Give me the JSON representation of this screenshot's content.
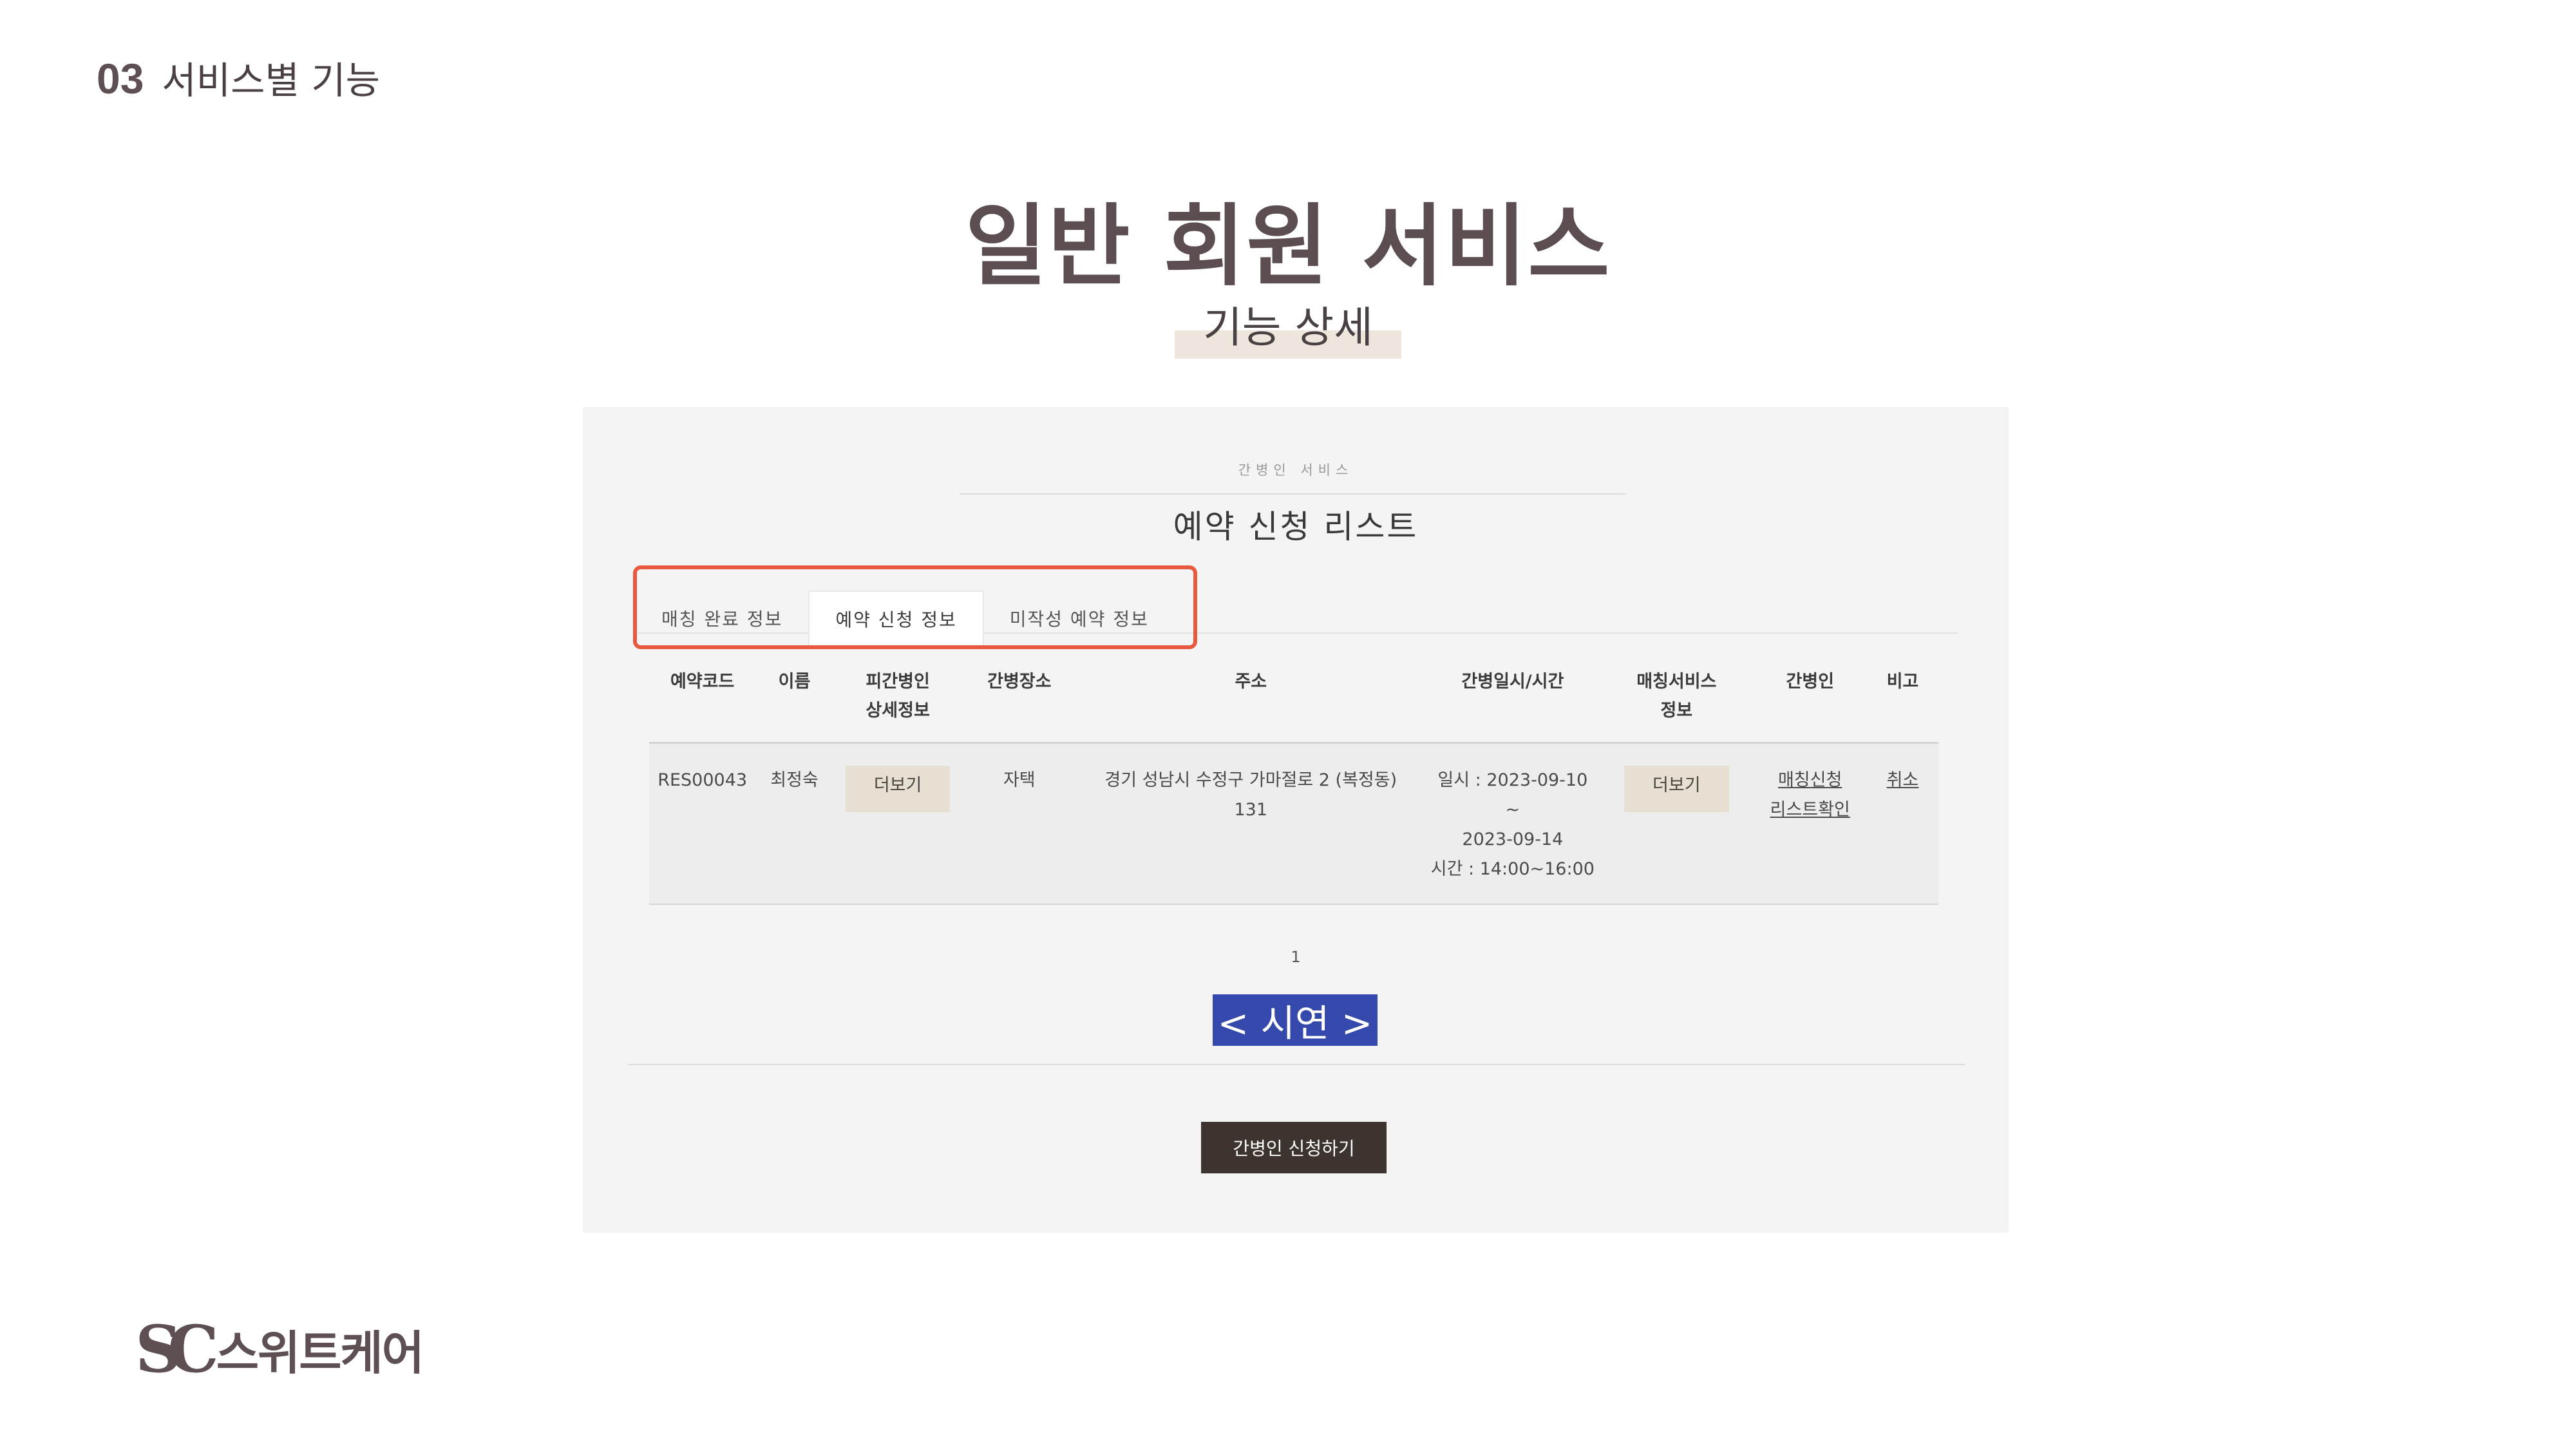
{
  "section": {
    "number": "03",
    "name": "서비스별 기능"
  },
  "title": "일반 회원 서비스",
  "subtitle": "기능 상세",
  "screen": {
    "breadcrumb": "간병인 서비스",
    "page_title": "예약 신청 리스트",
    "tabs": [
      {
        "label": "매칭 완료 정보",
        "active": false
      },
      {
        "label": "예약 신청 정보",
        "active": true
      },
      {
        "label": "미작성 예약 정보",
        "active": false
      }
    ],
    "table": {
      "headers": [
        [
          "예약코드"
        ],
        [
          "이름"
        ],
        [
          "피간병인",
          "상세정보"
        ],
        [
          "간병장소"
        ],
        [
          "주소"
        ],
        [
          "간병일시/시간"
        ],
        [
          "매칭서비스",
          "정보"
        ],
        [
          "간병인"
        ],
        [
          "비고"
        ]
      ],
      "rows": [
        {
          "code": "RES00043",
          "name": "최정숙",
          "patient_detail": "더보기",
          "place": "자택",
          "address": [
            "경기 성남시 수정구 가마절로 2 (복정동)",
            "131"
          ],
          "datetime": [
            "일시 : 2023-09-10",
            "~",
            "2023-09-14",
            "시간 : 14:00~16:00"
          ],
          "matching_info": "더보기",
          "caregiver": [
            "매칭신청",
            "리스트확인"
          ],
          "note": "취소"
        }
      ]
    },
    "pagination": "1",
    "demo_label": "< 시연 >",
    "apply_button": "간병인 신청하기",
    "colors": {
      "highlight_outline": "#e8593f",
      "demo_badge": "#3548ab",
      "apply_button": "#3d332f",
      "detail_button": "#e6dfd2"
    }
  },
  "brand": {
    "mark": "SC",
    "name": "스위트케어"
  }
}
